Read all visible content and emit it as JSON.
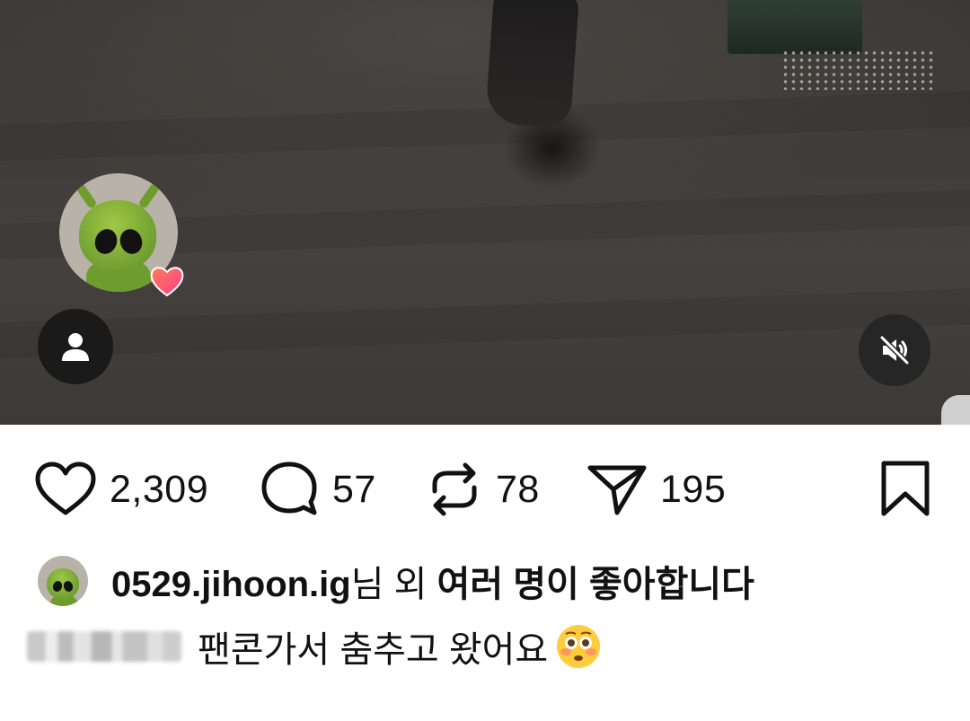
{
  "post": {
    "media": {
      "profile_button_icon": "person-icon",
      "mute_button_icon": "speaker-muted-icon",
      "avatar_badge_icon": "heart-icon"
    },
    "actions": {
      "like": {
        "icon": "heart-outline-icon",
        "count": "2,309"
      },
      "comment": {
        "icon": "comment-bubble-icon",
        "count": "57"
      },
      "repost": {
        "icon": "repost-icon",
        "count": "78"
      },
      "share": {
        "icon": "paper-plane-icon",
        "count": "195"
      },
      "save": {
        "icon": "bookmark-icon"
      }
    },
    "likes": {
      "username": "0529.jihoon.ig",
      "suffix": "님 외 ",
      "others": "여러 명이 좋아합니다"
    },
    "caption": {
      "text": "팬콘가서 춤추고 왔어요",
      "emoji": "flushed-face-emoji"
    }
  },
  "colors": {
    "text": "#111111",
    "background": "#ffffff",
    "button_dark": "#1a1a1a",
    "heart_badge": "#ff5a6e"
  }
}
